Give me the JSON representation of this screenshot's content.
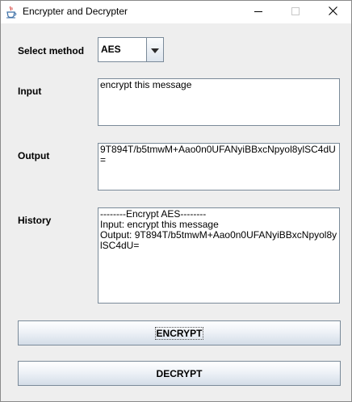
{
  "window": {
    "title": "Encrypter and Decrypter"
  },
  "labels": {
    "select_method": "Select method",
    "input": "Input",
    "output": "Output",
    "history": "History"
  },
  "method_select": {
    "selected": "AES"
  },
  "fields": {
    "input": "encrypt this message",
    "output": "9T894T/b5tmwM+Aao0n0UFANyiBBxcNpyol8ylSC4dU=",
    "history": "--------Encrypt AES--------\nInput: encrypt this message\nOutput: 9T894T/b5tmwM+Aao0n0UFANyiBBxcNpyol8ylSC4dU="
  },
  "buttons": {
    "encrypt": "ENCRYPT",
    "decrypt": "DECRYPT"
  },
  "icons": {
    "app": "java-cup-icon",
    "minimize": "minimize-icon",
    "maximize": "maximize-icon",
    "close": "close-icon",
    "dropdown": "chevron-down-icon"
  }
}
